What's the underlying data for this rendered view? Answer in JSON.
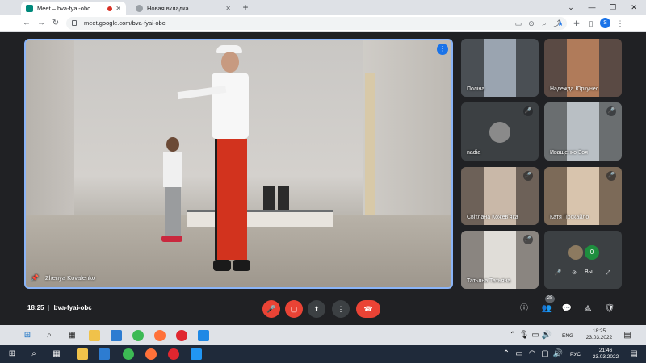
{
  "browser": {
    "tabs": [
      {
        "label": "Meet – bva-fyai-obc",
        "favicon_color": "#00897b"
      },
      {
        "label": "Новая вкладка",
        "favicon_color": "#5f6368"
      }
    ],
    "url": "meet.google.com/bva-fyai-obc",
    "profile_initial": "S",
    "new_tab_symbol": "+"
  },
  "meet": {
    "main_speaker": "Zhenya Kovalenko",
    "participants": [
      {
        "name": "Поліна",
        "muted": false,
        "bg": "#4a4f54",
        "img": "#9aa4b0"
      },
      {
        "name": "Надежда Юркунес",
        "muted": false,
        "bg": "#5a4a44",
        "img": "#b07b5a"
      },
      {
        "name": "nadia",
        "muted": true,
        "bg": "#3c4043",
        "img": "#8a8a8a"
      },
      {
        "name": "Иващенко Зоя",
        "muted": true,
        "bg": "#6a6e70",
        "img": "#b9bfc4"
      },
      {
        "name": "Світлана Кожевʼяка",
        "muted": true,
        "bg": "#6d6158",
        "img": "#c9b8a8"
      },
      {
        "name": "Катя Поскайло",
        "muted": true,
        "bg": "#7c6a58",
        "img": "#d8c4ad"
      },
      {
        "name": "Татьяна Татьяна",
        "muted": true,
        "bg": "#8a8580",
        "img": "#e0ddd8"
      }
    ],
    "self": {
      "name": "Вы",
      "count_badge": "0"
    },
    "time": "18:25",
    "meeting_code": "bva-fyai-obc",
    "participant_count": "28"
  },
  "taskbar_top": {
    "lang": "ENG",
    "time": "18:25",
    "date": "23.03.2022"
  },
  "taskbar_bottom": {
    "lang": "РУС",
    "time": "21:46",
    "date": "23.03.2022"
  },
  "colors": {
    "accent": "#8ab4f8",
    "danger": "#ea4335"
  }
}
